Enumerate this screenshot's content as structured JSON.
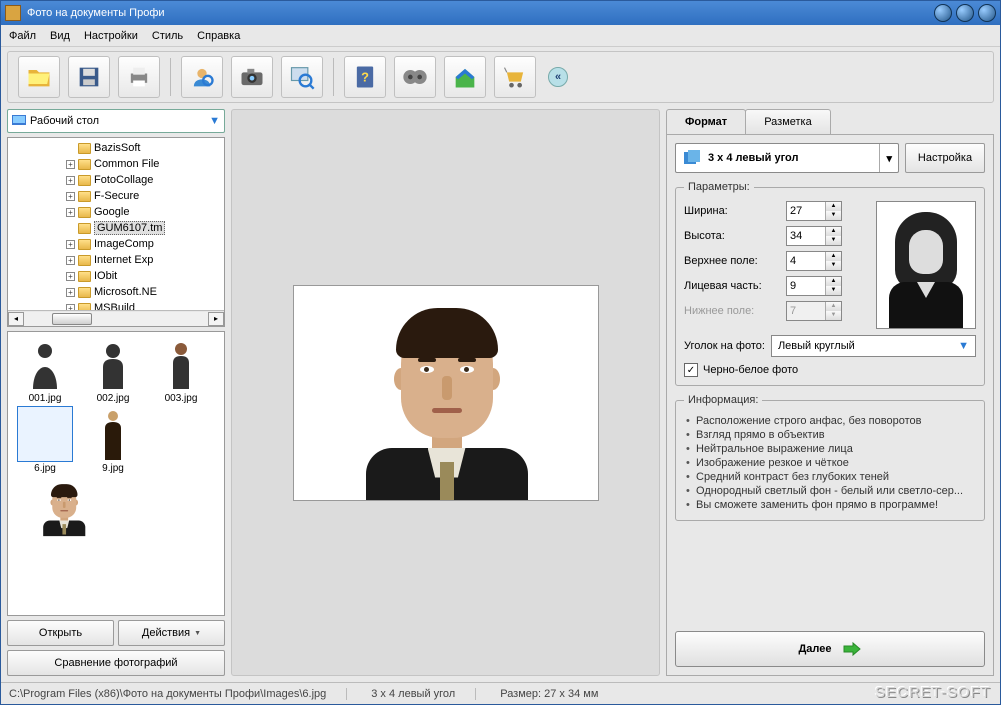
{
  "window": {
    "title": "Фото на документы Профи"
  },
  "menu": {
    "file": "Файл",
    "view": "Вид",
    "settings": "Настройки",
    "style": "Стиль",
    "help": "Справка"
  },
  "location": {
    "label": "Рабочий стол"
  },
  "tree": {
    "items": [
      {
        "name": "BazisSoft",
        "exp": false
      },
      {
        "name": "Common File",
        "exp": true
      },
      {
        "name": "FotoCollage",
        "exp": true
      },
      {
        "name": "F-Secure",
        "exp": true
      },
      {
        "name": "Google",
        "exp": true
      },
      {
        "name": "GUM6107.tm",
        "exp": false,
        "sel": true
      },
      {
        "name": "ImageComp",
        "exp": true
      },
      {
        "name": "Internet Exp",
        "exp": true
      },
      {
        "name": "IObit",
        "exp": true
      },
      {
        "name": "Microsoft.NE",
        "exp": true
      },
      {
        "name": "MSBuild",
        "exp": true
      }
    ]
  },
  "thumbs": [
    {
      "name": "001.jpg"
    },
    {
      "name": "002.jpg"
    },
    {
      "name": "003.jpg"
    },
    {
      "name": "6.jpg",
      "sel": true
    },
    {
      "name": "9.jpg"
    }
  ],
  "buttons": {
    "open": "Открыть",
    "actions": "Действия",
    "compare": "Сравнение фотографий"
  },
  "tabs": {
    "format": "Формат",
    "layout": "Разметка"
  },
  "format": {
    "selected": "3 x 4 левый угол",
    "configure": "Настройка",
    "params_title": "Параметры:",
    "width_label": "Ширина:",
    "width": "27",
    "height_label": "Высота:",
    "height": "34",
    "top_label": "Верхнее поле:",
    "top": "4",
    "face_label": "Лицевая часть:",
    "face": "9",
    "bottom_label": "Нижнее поле:",
    "bottom": "7",
    "corner_label": "Уголок на фото:",
    "corner_value": "Левый круглый",
    "bw_label": "Черно-белое фото"
  },
  "info": {
    "title": "Информация:",
    "items": [
      "Расположение строго анфас, без поворотов",
      "Взгляд прямо в объектив",
      "Нейтральное выражение лица",
      "Изображение резкое и чёткое",
      "Средний контраст без глубоких теней",
      "Однородный светлый фон - белый или светло-сер...",
      "Вы сможете заменить фон прямо в программе!"
    ]
  },
  "next": "Далее",
  "status": {
    "path": "C:\\Program Files (x86)\\Фото на документы Профи\\Images\\6.jpg",
    "format": "3 x 4 левый угол",
    "size": "Размер: 27 x 34 мм"
  },
  "watermark": "SECRET-SOFT"
}
